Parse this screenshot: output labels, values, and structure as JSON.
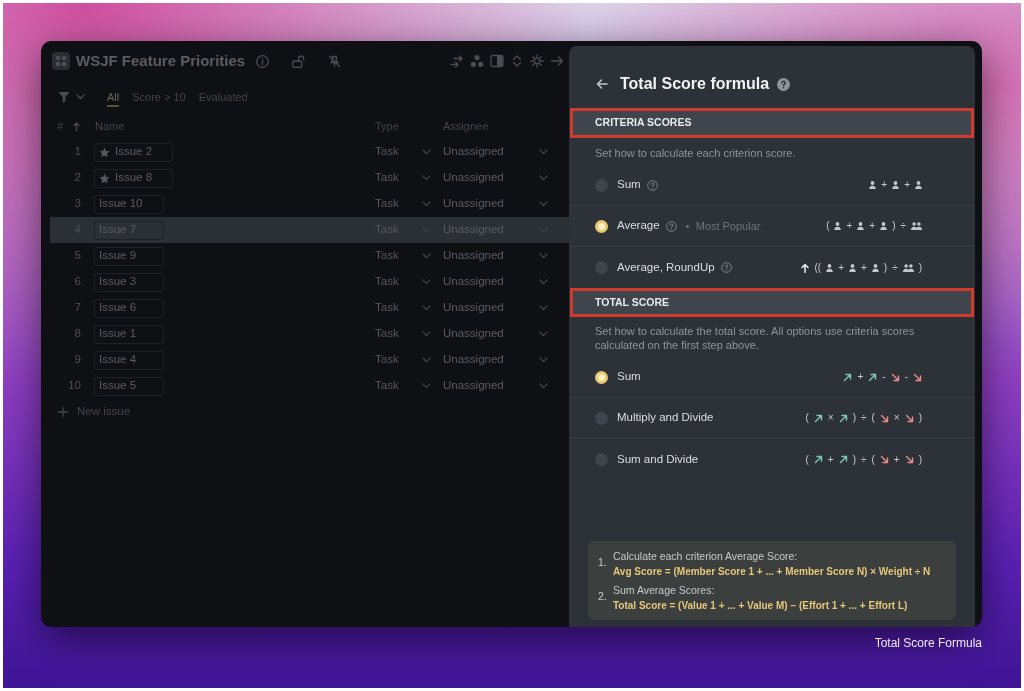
{
  "board": {
    "title": "WSJF Feature Priorities",
    "filters": [
      {
        "label": "All",
        "selected": true
      },
      {
        "label": "Score > 10",
        "selected": false
      },
      {
        "label": "Evaluated",
        "selected": false
      }
    ],
    "columns": [
      "#",
      "Name",
      "Type",
      "Assignee"
    ],
    "rows": [
      {
        "number": "1",
        "name": "Issue 2",
        "starred": true,
        "type": "Task",
        "assignee": "Unassigned",
        "highlighted": false
      },
      {
        "number": "2",
        "name": "Issue 8",
        "starred": true,
        "type": "Task",
        "assignee": "Unassigned",
        "highlighted": false
      },
      {
        "number": "3",
        "name": "Issue 10",
        "starred": false,
        "type": "Task",
        "assignee": "Unassigned",
        "highlighted": false
      },
      {
        "number": "4",
        "name": "Issue 7",
        "starred": false,
        "type": "Task",
        "assignee": "Unassigned",
        "highlighted": true
      },
      {
        "number": "5",
        "name": "Issue 9",
        "starred": false,
        "type": "Task",
        "assignee": "Unassigned",
        "highlighted": false
      },
      {
        "number": "6",
        "name": "Issue 3",
        "starred": false,
        "type": "Task",
        "assignee": "Unassigned",
        "highlighted": false
      },
      {
        "number": "7",
        "name": "Issue 6",
        "starred": false,
        "type": "Task",
        "assignee": "Unassigned",
        "highlighted": false
      },
      {
        "number": "8",
        "name": "Issue 1",
        "starred": false,
        "type": "Task",
        "assignee": "Unassigned",
        "highlighted": false
      },
      {
        "number": "9",
        "name": "Issue 4",
        "starred": false,
        "type": "Task",
        "assignee": "Unassigned",
        "highlighted": false
      },
      {
        "number": "10",
        "name": "Issue 5",
        "starred": false,
        "type": "Task",
        "assignee": "Unassigned",
        "highlighted": false
      }
    ],
    "new_issue": "New issue"
  },
  "panel": {
    "title": "Total Score formula",
    "sections": [
      {
        "heading": "CRITERIA SCORES",
        "outlined": true,
        "description": "Set how to calculate each criterion score.",
        "options": [
          {
            "label": "Sum",
            "selected": false,
            "help": true,
            "formula": [
              {
                "kind": "person"
              },
              {
                "kind": "operator",
                "text": "+"
              },
              {
                "kind": "person"
              },
              {
                "kind": "operator",
                "text": "+"
              },
              {
                "kind": "person"
              }
            ]
          },
          {
            "label": "Average",
            "selected": true,
            "help": true,
            "note": "Most Popular",
            "formula": [
              {
                "kind": "operator",
                "text": "("
              },
              {
                "kind": "person"
              },
              {
                "kind": "operator",
                "text": "+"
              },
              {
                "kind": "person"
              },
              {
                "kind": "operator",
                "text": "+"
              },
              {
                "kind": "person"
              },
              {
                "kind": "operator",
                "text": ")"
              },
              {
                "kind": "operator",
                "text": "÷"
              },
              {
                "kind": "people"
              }
            ]
          },
          {
            "label": "Average, RoundUp",
            "selected": false,
            "help": true,
            "formula": [
              {
                "kind": "ceiling_arrow"
              },
              {
                "kind": "operator",
                "text": "(("
              },
              {
                "kind": "person"
              },
              {
                "kind": "operator",
                "text": "+"
              },
              {
                "kind": "person"
              },
              {
                "kind": "operator",
                "text": "+"
              },
              {
                "kind": "person"
              },
              {
                "kind": "operator",
                "text": ")"
              },
              {
                "kind": "operator",
                "text": "÷"
              },
              {
                "kind": "people"
              },
              {
                "kind": "operator",
                "text": ")"
              }
            ]
          }
        ]
      },
      {
        "heading": "TOTAL SCORE",
        "outlined": true,
        "description": "Set how to calculate the total score. All options use criteria scores calculated on the first step above.",
        "options": [
          {
            "label": "Sum",
            "selected": true,
            "help": false,
            "formula": [
              {
                "kind": "up_arrow"
              },
              {
                "kind": "operator",
                "text": "+"
              },
              {
                "kind": "up_arrow"
              },
              {
                "kind": "operator",
                "text": "-"
              },
              {
                "kind": "down_arrow"
              },
              {
                "kind": "operator",
                "text": "-"
              },
              {
                "kind": "down_arrow"
              }
            ]
          },
          {
            "label": "Multiply and Divide",
            "selected": false,
            "help": false,
            "formula": [
              {
                "kind": "operator",
                "text": "("
              },
              {
                "kind": "up_arrow"
              },
              {
                "kind": "operator",
                "text": "×"
              },
              {
                "kind": "up_arrow"
              },
              {
                "kind": "operator",
                "text": ")"
              },
              {
                "kind": "operator",
                "text": "÷"
              },
              {
                "kind": "operator",
                "text": "("
              },
              {
                "kind": "down_arrow"
              },
              {
                "kind": "operator",
                "text": "×"
              },
              {
                "kind": "down_arrow"
              },
              {
                "kind": "operator",
                "text": ")"
              }
            ]
          },
          {
            "label": "Sum and Divide",
            "selected": false,
            "help": false,
            "formula": [
              {
                "kind": "operator",
                "text": "("
              },
              {
                "kind": "up_arrow"
              },
              {
                "kind": "operator",
                "text": "+"
              },
              {
                "kind": "up_arrow"
              },
              {
                "kind": "operator",
                "text": ")"
              },
              {
                "kind": "operator",
                "text": "÷"
              },
              {
                "kind": "operator",
                "text": "("
              },
              {
                "kind": "down_arrow"
              },
              {
                "kind": "operator",
                "text": "+"
              },
              {
                "kind": "down_arrow"
              },
              {
                "kind": "operator",
                "text": ")"
              }
            ]
          }
        ]
      }
    ],
    "notes": [
      {
        "number": "1.",
        "text": "Calculate each criterion Average Score:",
        "formula": "Avg Score = (Member Score 1 + ... + Member Score N) × Weight ÷ N"
      },
      {
        "number": "2.",
        "text": "Sum Average Scores:",
        "formula": "Total Score = (Value 1 + ... + Value M) − (Effort 1 + ... + Effort L)"
      }
    ]
  },
  "caption": "Total Score Formula"
}
